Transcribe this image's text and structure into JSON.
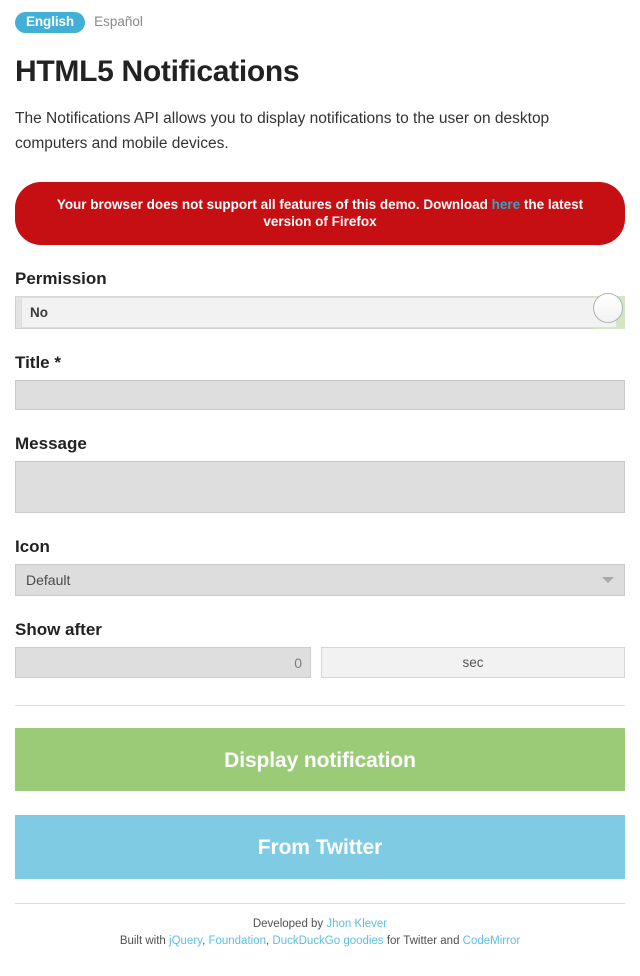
{
  "lang": {
    "active": "English",
    "other": "Español"
  },
  "header": {
    "title": "HTML5 Notifications",
    "description": "The Notifications API allows you to display notifications to the user on desktop computers and mobile devices."
  },
  "alert": {
    "text_before": "Your browser does not support all features of this demo. Download ",
    "link": "here",
    "text_after": " the latest version of Firefox",
    "bg_color": "#c60f13",
    "link_color": "#2ba6cb"
  },
  "form": {
    "permission": {
      "label": "Permission",
      "value": "No",
      "toggle_state": "off",
      "track_on_color": "#d3e6c1"
    },
    "title": {
      "label": "Title *",
      "value": "",
      "placeholder": ""
    },
    "message": {
      "label": "Message",
      "value": "",
      "placeholder": ""
    },
    "icon": {
      "label": "Icon",
      "selected": "Default",
      "arrow_icon": "chevron-down-icon"
    },
    "show_after": {
      "label": "Show after",
      "value": "0",
      "placeholder": "0",
      "unit": "sec"
    }
  },
  "actions": {
    "display": {
      "label": "Display notification",
      "color": "#9ccb78"
    },
    "twitter": {
      "label": "From Twitter",
      "color": "#7fcbe4"
    }
  },
  "footer": {
    "line1_prefix": "Developed by ",
    "author": "Jhon Klever",
    "line2_prefix": "Built with ",
    "lib1": "jQuery",
    "sep1": ", ",
    "lib2": "Foundation",
    "sep2": ", ",
    "lib3": "DuckDuckGo goodies",
    "mid": " for Twitter and ",
    "lib4": "CodeMirror",
    "link_color": "#5bbfe0"
  }
}
